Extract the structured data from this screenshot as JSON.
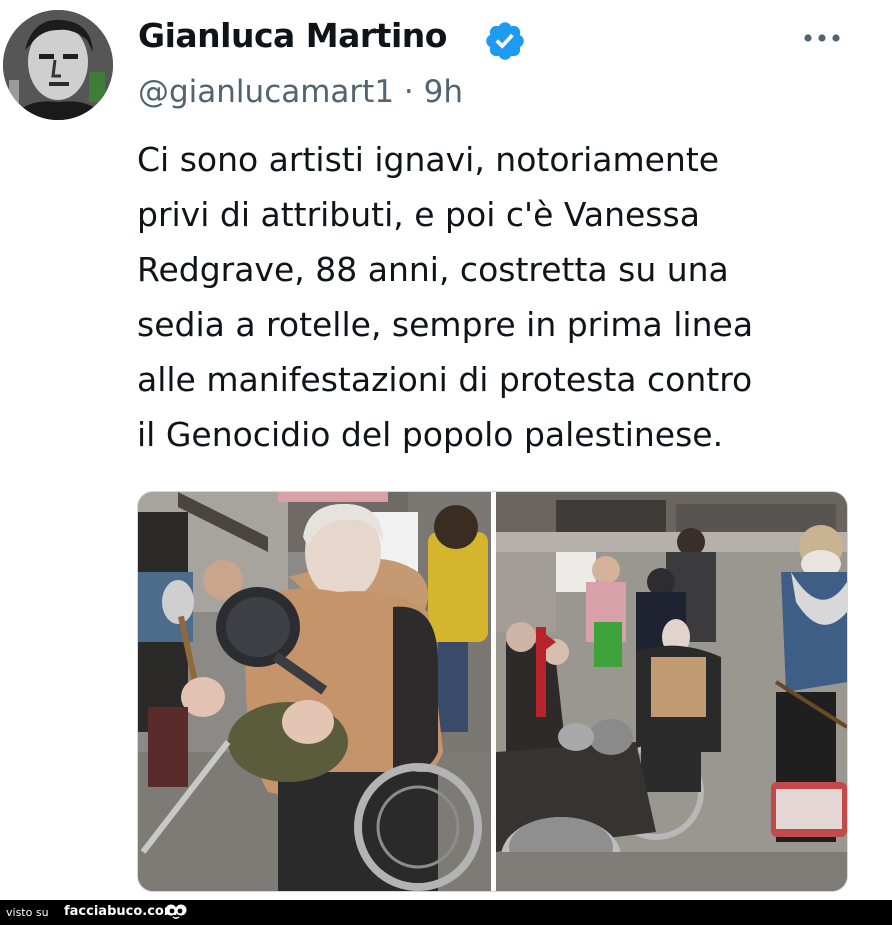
{
  "tweet": {
    "author_name": "Gianluca Martino",
    "handle": "@gianlucamart1",
    "separator": "·",
    "time": "9h",
    "verified_icon": "verified-badge-icon",
    "more_icon": "more-options-icon",
    "text_lines": [
      "Ci sono artisti ignavi, notoriamente",
      "privi di attributi, e poi c'è Vanessa",
      "Redgrave, 88 anni, costretta su una",
      "sedia a rotelle, sempre in prima linea",
      "alle manifestazioni di protesta contro",
      "il Genocidio del popolo palestinese."
    ],
    "accent_color": "#1d9bf0"
  },
  "footer": {
    "prefix": "visto su",
    "site": "facciabuco.com",
    "logo_icon": "facciabuco-logo-icon"
  }
}
